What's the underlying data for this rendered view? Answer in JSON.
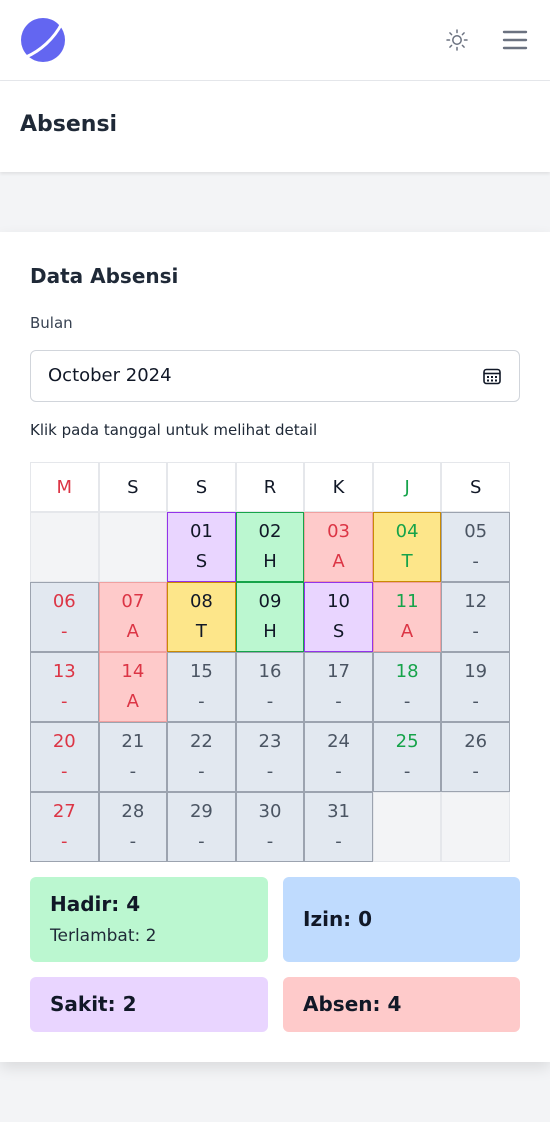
{
  "header": {
    "logo_icon": "planet-logo-icon",
    "theme_icon": "sun-icon",
    "menu_icon": "hamburger-menu-icon"
  },
  "page": {
    "title": "Absensi"
  },
  "card": {
    "title": "Data Absensi",
    "month_label": "Bulan",
    "month_value": "October 2024",
    "hint": "Klik pada tanggal untuk melihat detail"
  },
  "calendar": {
    "weekdays": [
      "M",
      "S",
      "S",
      "R",
      "K",
      "J",
      "S"
    ],
    "weeks": [
      [
        null,
        null,
        {
          "d": "01",
          "s": "S"
        },
        {
          "d": "02",
          "s": "H"
        },
        {
          "d": "03",
          "s": "A"
        },
        {
          "d": "04",
          "s": "T"
        },
        {
          "d": "05",
          "s": "-"
        }
      ],
      [
        {
          "d": "06",
          "s": "-"
        },
        {
          "d": "07",
          "s": "A"
        },
        {
          "d": "08",
          "s": "T"
        },
        {
          "d": "09",
          "s": "H"
        },
        {
          "d": "10",
          "s": "S"
        },
        {
          "d": "11",
          "s": "A"
        },
        {
          "d": "12",
          "s": "-"
        }
      ],
      [
        {
          "d": "13",
          "s": "-"
        },
        {
          "d": "14",
          "s": "A"
        },
        {
          "d": "15",
          "s": "-"
        },
        {
          "d": "16",
          "s": "-"
        },
        {
          "d": "17",
          "s": "-"
        },
        {
          "d": "18",
          "s": "-"
        },
        {
          "d": "19",
          "s": "-"
        }
      ],
      [
        {
          "d": "20",
          "s": "-"
        },
        {
          "d": "21",
          "s": "-"
        },
        {
          "d": "22",
          "s": "-"
        },
        {
          "d": "23",
          "s": "-"
        },
        {
          "d": "24",
          "s": "-"
        },
        {
          "d": "25",
          "s": "-"
        },
        {
          "d": "26",
          "s": "-"
        }
      ],
      [
        {
          "d": "27",
          "s": "-"
        },
        {
          "d": "28",
          "s": "-"
        },
        {
          "d": "29",
          "s": "-"
        },
        {
          "d": "30",
          "s": "-"
        },
        {
          "d": "31",
          "s": "-"
        },
        null,
        null
      ]
    ],
    "colors": {
      "S": "#e9d5ff",
      "H": "#bbf7d0",
      "A": "#fecaca",
      "T": "#fde68a",
      "-": "#e2e8f0"
    }
  },
  "summary": {
    "hadir": "Hadir: 4",
    "terlambat": "Terlambat: 2",
    "izin": "Izin: 0",
    "sakit": "Sakit: 2",
    "absen": "Absen: 4"
  }
}
